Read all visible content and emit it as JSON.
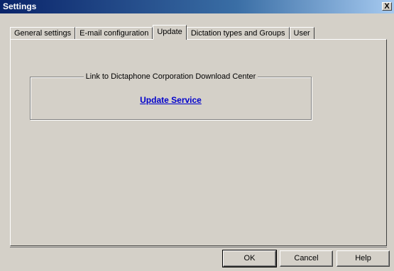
{
  "window": {
    "title": "Settings",
    "close_label": "X"
  },
  "tabs": [
    {
      "label": "General settings",
      "active": false
    },
    {
      "label": "E-mail configuration",
      "active": false
    },
    {
      "label": "Update",
      "active": true
    },
    {
      "label": "Dictation types and Groups",
      "active": false
    },
    {
      "label": "User",
      "active": false
    }
  ],
  "update": {
    "group_title": "Link to Dictaphone Corporation Download Center",
    "link_label": "Update Service"
  },
  "buttons": {
    "ok": "OK",
    "cancel": "Cancel",
    "help": "Help"
  },
  "colors": {
    "titlebar_start": "#0a246a",
    "titlebar_end": "#a6caf0",
    "link": "#0000cc",
    "face": "#d4d0c8"
  }
}
